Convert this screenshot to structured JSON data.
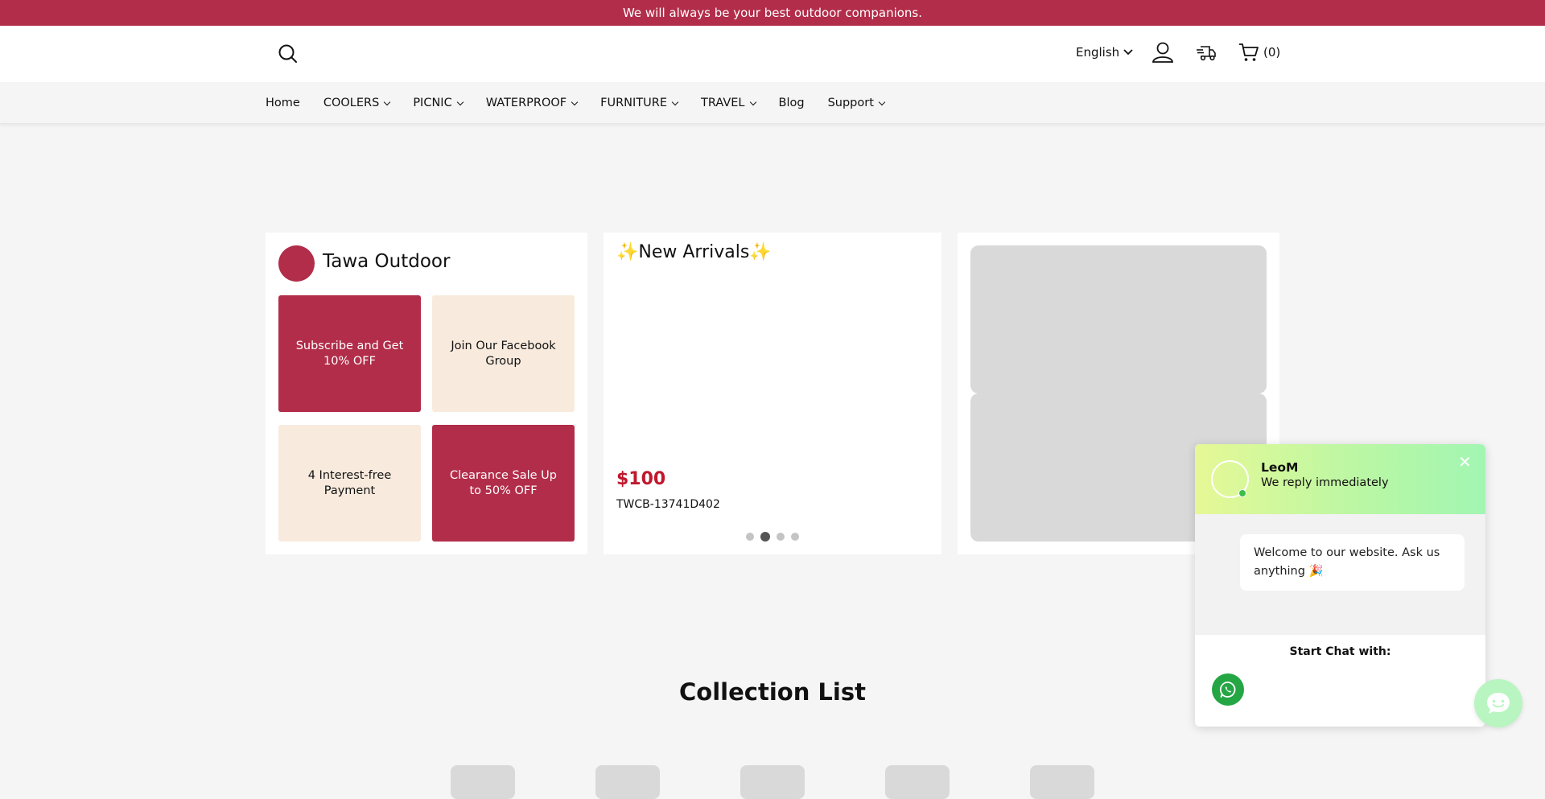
{
  "announcement": {
    "text": "We will always be your best outdoor companions."
  },
  "header": {
    "language": "English",
    "cart_count": "(0)"
  },
  "nav": {
    "items": [
      {
        "label": "Home",
        "dropdown": false
      },
      {
        "label": "COOLERS",
        "dropdown": true
      },
      {
        "label": "PICNIC",
        "dropdown": true
      },
      {
        "label": "WATERPROOF",
        "dropdown": true
      },
      {
        "label": "FURNITURE",
        "dropdown": true
      },
      {
        "label": "TRAVEL",
        "dropdown": true
      },
      {
        "label": "Blog",
        "dropdown": false
      },
      {
        "label": "Support",
        "dropdown": true
      }
    ]
  },
  "brand_card": {
    "name": "Tawa Outdoor",
    "tiles": [
      {
        "label": "Subscribe and Get 10% OFF"
      },
      {
        "label": "Join Our Facebook Group"
      },
      {
        "label": "4 Interest-free Payment"
      },
      {
        "label": "Clearance Sale Up to 50% OFF"
      }
    ]
  },
  "new_arrivals": {
    "title": "✨New Arrivals✨",
    "price": "$100",
    "sku": "TWCB-13741D402",
    "slide_count": 4,
    "active_slide": 2
  },
  "collection": {
    "title": "Collection List"
  },
  "chat_widget": {
    "agent_name": "LeoM",
    "status": "We reply immediately",
    "close_symbol": "✕",
    "welcome_message": "Welcome to our website. Ask us anything 🎉",
    "start_label": "Start Chat with:"
  },
  "colors": {
    "brand": "#b22d4a",
    "beige": "#f8ebde",
    "price": "#c0182c",
    "whatsapp": "#25a644"
  }
}
